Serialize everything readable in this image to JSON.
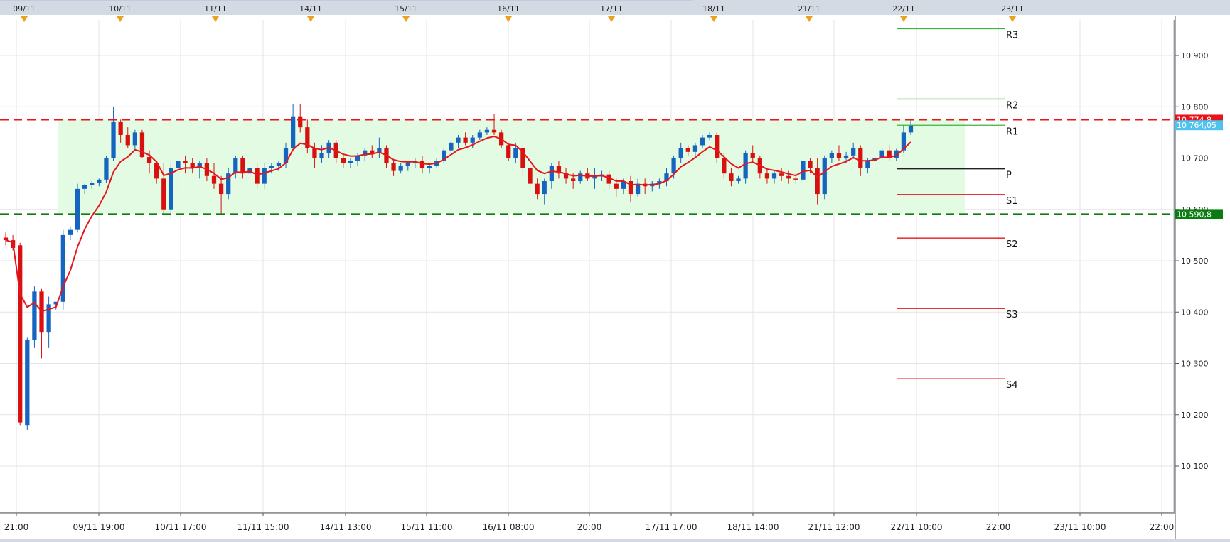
{
  "chart_data": {
    "type": "candlestick",
    "title": "",
    "ylim": [
      10020,
      10970
    ],
    "y_ticks": [
      10100,
      10200,
      10300,
      10400,
      10500,
      10600,
      10700,
      10800,
      10900
    ],
    "y_tick_labels": [
      "10 100",
      "10 200",
      "10 300",
      "10 400",
      "10 500",
      "10 600",
      "10 700",
      "10 800",
      "10 900"
    ],
    "top_date_labels": [
      "09/11",
      "10/11",
      "11/11",
      "14/11",
      "15/11",
      "16/11",
      "17/11",
      "18/11",
      "21/11",
      "22/11",
      "23/11"
    ],
    "bottom_time_labels": [
      "21:00",
      "09/11 19:00",
      "10/11 17:00",
      "11/11 15:00",
      "14/11 13:00",
      "15/11 11:00",
      "16/11 08:00",
      "20:00",
      "17/11 17:00",
      "18/11 14:00",
      "21/11 12:00",
      "22/11 10:00",
      "22:00",
      "23/11 10:00",
      "22:00"
    ],
    "range_zone": {
      "low": 10590.8,
      "high": 10774.8
    },
    "resistance_line": {
      "value": 10774.8,
      "label": "10 774,8",
      "color": "#e8141c"
    },
    "support_line": {
      "value": 10590.8,
      "label": "10 590,8",
      "color": "#0a7d10"
    },
    "last_price": {
      "value": 10764.05,
      "label": "10 764,05",
      "color": "#4fc3ef"
    },
    "pivot_levels": [
      {
        "name": "R3",
        "value": 10952,
        "color": "#3cb43c"
      },
      {
        "name": "R2",
        "value": 10815,
        "color": "#3cb43c"
      },
      {
        "name": "R1",
        "value": 10764,
        "color": "#3cb43c"
      },
      {
        "name": "P",
        "value": 10679,
        "color": "#222222"
      },
      {
        "name": "S1",
        "value": 10629,
        "color": "#e8141c"
      },
      {
        "name": "S2",
        "value": 10544,
        "color": "#e8141c"
      },
      {
        "name": "S3",
        "value": 10407,
        "color": "#e8141c"
      },
      {
        "name": "S4",
        "value": 10270,
        "color": "#e8141c"
      }
    ],
    "candles": [
      [
        10545,
        10555,
        10530,
        10540
      ],
      [
        10540,
        10550,
        10520,
        10525
      ],
      [
        10530,
        10535,
        10180,
        10185
      ],
      [
        10180,
        10350,
        10170,
        10345
      ],
      [
        10345,
        10450,
        10330,
        10440
      ],
      [
        10440,
        10445,
        10310,
        10360
      ],
      [
        10360,
        10430,
        10330,
        10415
      ],
      [
        10415,
        10420,
        10405,
        10420
      ],
      [
        10420,
        10560,
        10405,
        10550
      ],
      [
        10550,
        10565,
        10540,
        10560
      ],
      [
        10560,
        10650,
        10555,
        10640
      ],
      [
        10640,
        10650,
        10630,
        10648
      ],
      [
        10648,
        10655,
        10640,
        10652
      ],
      [
        10652,
        10660,
        10645,
        10658
      ],
      [
        10658,
        10705,
        10652,
        10700
      ],
      [
        10700,
        10800,
        10695,
        10770
      ],
      [
        10770,
        10775,
        10730,
        10745
      ],
      [
        10745,
        10760,
        10720,
        10725
      ],
      [
        10725,
        10755,
        10715,
        10750
      ],
      [
        10750,
        10755,
        10700,
        10702
      ],
      [
        10702,
        10715,
        10670,
        10690
      ],
      [
        10690,
        10695,
        10650,
        10660
      ],
      [
        10660,
        10690,
        10590,
        10600
      ],
      [
        10600,
        10690,
        10580,
        10680
      ],
      [
        10680,
        10700,
        10640,
        10695
      ],
      [
        10695,
        10705,
        10670,
        10690
      ],
      [
        10690,
        10700,
        10670,
        10680
      ],
      [
        10680,
        10695,
        10660,
        10690
      ],
      [
        10690,
        10700,
        10655,
        10665
      ],
      [
        10665,
        10690,
        10640,
        10650
      ],
      [
        10650,
        10665,
        10590,
        10630
      ],
      [
        10630,
        10680,
        10620,
        10670
      ],
      [
        10670,
        10705,
        10660,
        10700
      ],
      [
        10700,
        10705,
        10660,
        10670
      ],
      [
        10670,
        10690,
        10650,
        10680
      ],
      [
        10680,
        10690,
        10640,
        10650
      ],
      [
        10650,
        10690,
        10640,
        10680
      ],
      [
        10680,
        10690,
        10670,
        10685
      ],
      [
        10685,
        10695,
        10675,
        10690
      ],
      [
        10690,
        10730,
        10680,
        10720
      ],
      [
        10720,
        10805,
        10715,
        10780
      ],
      [
        10780,
        10805,
        10750,
        10760
      ],
      [
        10760,
        10775,
        10710,
        10720
      ],
      [
        10720,
        10730,
        10680,
        10700
      ],
      [
        10700,
        10725,
        10690,
        10710
      ],
      [
        10710,
        10735,
        10700,
        10730
      ],
      [
        10730,
        10735,
        10690,
        10700
      ],
      [
        10700,
        10710,
        10680,
        10690
      ],
      [
        10690,
        10700,
        10680,
        10695
      ],
      [
        10695,
        10710,
        10685,
        10705
      ],
      [
        10705,
        10720,
        10695,
        10715
      ],
      [
        10715,
        10725,
        10700,
        10710
      ],
      [
        10710,
        10740,
        10700,
        10720
      ],
      [
        10720,
        10725,
        10680,
        10690
      ],
      [
        10690,
        10695,
        10665,
        10675
      ],
      [
        10675,
        10690,
        10670,
        10685
      ],
      [
        10685,
        10695,
        10675,
        10690
      ],
      [
        10690,
        10700,
        10680,
        10695
      ],
      [
        10695,
        10705,
        10670,
        10680
      ],
      [
        10680,
        10690,
        10670,
        10685
      ],
      [
        10685,
        10700,
        10680,
        10695
      ],
      [
        10695,
        10720,
        10690,
        10715
      ],
      [
        10715,
        10735,
        10710,
        10730
      ],
      [
        10730,
        10745,
        10720,
        10740
      ],
      [
        10740,
        10750,
        10725,
        10730
      ],
      [
        10730,
        10745,
        10720,
        10740
      ],
      [
        10740,
        10755,
        10735,
        10750
      ],
      [
        10750,
        10760,
        10745,
        10755
      ],
      [
        10755,
        10785,
        10745,
        10750
      ],
      [
        10750,
        10755,
        10720,
        10725
      ],
      [
        10725,
        10730,
        10695,
        10700
      ],
      [
        10700,
        10730,
        10690,
        10720
      ],
      [
        10720,
        10725,
        10665,
        10680
      ],
      [
        10680,
        10690,
        10640,
        10650
      ],
      [
        10650,
        10660,
        10620,
        10630
      ],
      [
        10630,
        10660,
        10610,
        10655
      ],
      [
        10655,
        10690,
        10640,
        10685
      ],
      [
        10685,
        10695,
        10660,
        10670
      ],
      [
        10670,
        10680,
        10650,
        10660
      ],
      [
        10660,
        10670,
        10640,
        10655
      ],
      [
        10655,
        10675,
        10650,
        10670
      ],
      [
        10670,
        10680,
        10655,
        10660
      ],
      [
        10660,
        10680,
        10640,
        10665
      ],
      [
        10665,
        10675,
        10655,
        10668
      ],
      [
        10668,
        10675,
        10640,
        10650
      ],
      [
        10650,
        10660,
        10625,
        10640
      ],
      [
        10640,
        10660,
        10630,
        10655
      ],
      [
        10655,
        10665,
        10615,
        10630
      ],
      [
        10630,
        10660,
        10625,
        10650
      ],
      [
        10650,
        10660,
        10630,
        10645
      ],
      [
        10645,
        10655,
        10635,
        10650
      ],
      [
        10650,
        10660,
        10640,
        10655
      ],
      [
        10655,
        10680,
        10645,
        10670
      ],
      [
        10670,
        10705,
        10660,
        10700
      ],
      [
        10700,
        10730,
        10690,
        10720
      ],
      [
        10720,
        10725,
        10705,
        10712
      ],
      [
        10712,
        10730,
        10705,
        10725
      ],
      [
        10725,
        10745,
        10720,
        10740
      ],
      [
        10740,
        10750,
        10735,
        10745
      ],
      [
        10745,
        10750,
        10690,
        10700
      ],
      [
        10700,
        10710,
        10660,
        10670
      ],
      [
        10670,
        10680,
        10645,
        10655
      ],
      [
        10655,
        10665,
        10650,
        10660
      ],
      [
        10660,
        10715,
        10650,
        10710
      ],
      [
        10710,
        10725,
        10690,
        10700
      ],
      [
        10700,
        10705,
        10660,
        10670
      ],
      [
        10670,
        10680,
        10650,
        10660
      ],
      [
        10660,
        10675,
        10650,
        10670
      ],
      [
        10670,
        10680,
        10655,
        10665
      ],
      [
        10665,
        10675,
        10650,
        10660
      ],
      [
        10660,
        10670,
        10650,
        10658
      ],
      [
        10658,
        10700,
        10650,
        10695
      ],
      [
        10695,
        10700,
        10670,
        10680
      ],
      [
        10680,
        10700,
        10610,
        10630
      ],
      [
        10630,
        10705,
        10620,
        10700
      ],
      [
        10700,
        10715,
        10690,
        10710
      ],
      [
        10710,
        10725,
        10695,
        10700
      ],
      [
        10700,
        10712,
        10690,
        10705
      ],
      [
        10705,
        10730,
        10700,
        10720
      ],
      [
        10720,
        10725,
        10665,
        10680
      ],
      [
        10680,
        10700,
        10670,
        10695
      ],
      [
        10695,
        10705,
        10690,
        10700
      ],
      [
        10700,
        10720,
        10695,
        10715
      ],
      [
        10715,
        10725,
        10695,
        10700
      ],
      [
        10700,
        10718,
        10695,
        10715
      ],
      [
        10715,
        10765,
        10710,
        10750
      ],
      [
        10750,
        10775,
        10745,
        10764
      ]
    ],
    "ma_color": "#e8141c",
    "bull_color": "#1565c0",
    "bear_color": "#d81010"
  }
}
